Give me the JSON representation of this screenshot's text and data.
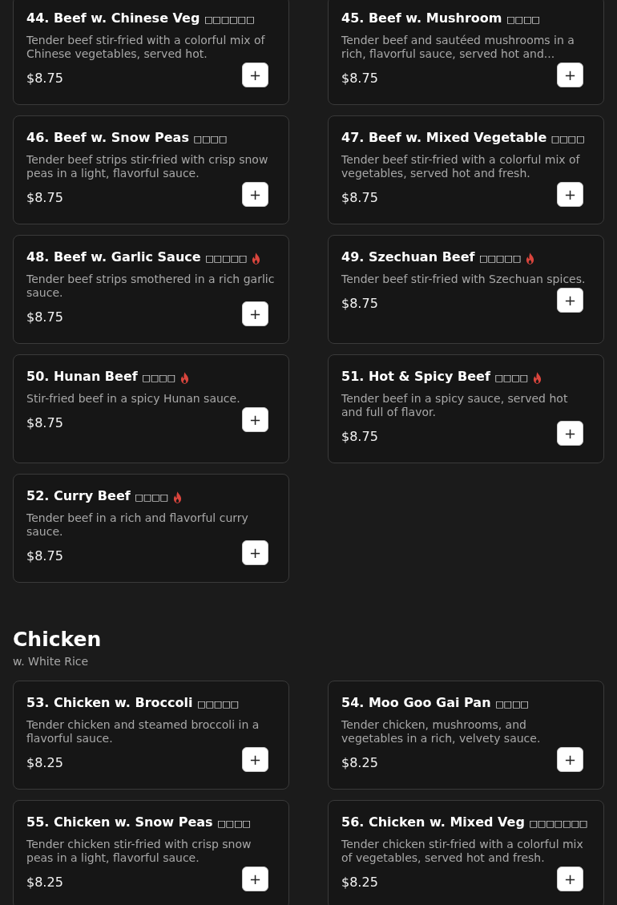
{
  "sections": [
    {
      "items": [
        {
          "name": "44. Beef w. Chinese Veg",
          "chinese": "□□□□□□",
          "spicy": false,
          "description": "Tender beef stir-fried with a colorful mix of Chinese vegetables, served hot.",
          "price": "$8.75",
          "button": "+"
        },
        {
          "name": "45. Beef w. Mushroom",
          "chinese": "□□□□",
          "spicy": false,
          "description": "Tender beef and sautéed mushrooms in a rich, flavorful sauce, served hot and...",
          "price": "$8.75",
          "button": "+"
        },
        {
          "name": "46. Beef w. Snow Peas",
          "chinese": "□□□□",
          "spicy": false,
          "description": "Tender beef strips stir-fried with crisp snow peas in a light, flavorful sauce.",
          "price": "$8.75",
          "button": "+"
        },
        {
          "name": "47. Beef w. Mixed Vegetable",
          "chinese": "□□□□",
          "spicy": false,
          "description": "Tender beef stir-fried with a colorful mix of vegetables, served hot and fresh.",
          "price": "$8.75",
          "button": "+"
        },
        {
          "name": "48. Beef w. Garlic Sauce",
          "chinese": "□□□□□",
          "spicy": true,
          "description": "Tender beef strips smothered in a rich garlic sauce.",
          "price": "$8.75",
          "button": "+"
        },
        {
          "name": "49. Szechuan Beef",
          "chinese": "□□□□□",
          "spicy": true,
          "description": "Tender beef stir-fried with Szechuan spices.",
          "price": "$8.75",
          "button": "+"
        },
        {
          "name": "50. Hunan Beef",
          "chinese": "□□□□",
          "spicy": true,
          "description": "Stir-fried beef in a spicy Hunan sauce.",
          "price": "$8.75",
          "button": "+"
        },
        {
          "name": "51. Hot & Spicy Beef",
          "chinese": "□□□□",
          "spicy": true,
          "description": "Tender beef in a spicy sauce, served hot and full of flavor.",
          "price": "$8.75",
          "button": "+"
        },
        {
          "name": "52. Curry Beef",
          "chinese": "□□□□",
          "spicy": true,
          "description": "Tender beef in a rich and flavorful curry sauce.",
          "price": "$8.75",
          "button": "+"
        }
      ]
    },
    {
      "title": "Chicken",
      "subtitle": "w. White Rice",
      "items": [
        {
          "name": "53. Chicken w. Broccoli",
          "chinese": "□□□□□",
          "spicy": false,
          "description": "Tender chicken and steamed broccoli in a flavorful sauce.",
          "price": "$8.25",
          "button": "+"
        },
        {
          "name": "54. Moo Goo Gai Pan",
          "chinese": "□□□□",
          "spicy": false,
          "description": "Tender chicken, mushrooms, and vegetables in a rich, velvety sauce.",
          "price": "$8.25",
          "button": "+"
        },
        {
          "name": "55. Chicken w. Snow Peas",
          "chinese": "□□□□",
          "spicy": false,
          "description": "Tender chicken stir-fried with crisp snow peas in a light, flavorful sauce.",
          "price": "$8.25",
          "button": "+"
        },
        {
          "name": "56. Chicken w. Mixed Veg",
          "chinese": "□□□□□□□",
          "spicy": false,
          "description": "Tender chicken stir-fried with a colorful mix of vegetables, served hot and fresh.",
          "price": "$8.25",
          "button": "+"
        }
      ]
    }
  ]
}
